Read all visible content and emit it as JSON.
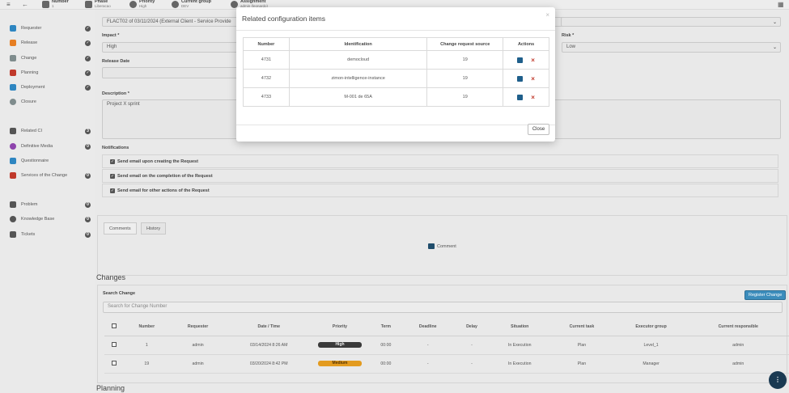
{
  "topbar": {
    "menu_icon": "menu-icon",
    "back_icon": "back-arrow-icon",
    "items": [
      {
        "label": "Number",
        "value": "1"
      },
      {
        "label": "Phase",
        "value": "Liberacao"
      },
      {
        "label": "Priority",
        "value": "High"
      },
      {
        "label": "Current group",
        "value": "DEV"
      },
      {
        "label": "Assignment",
        "value": "admin (leonardo)"
      }
    ],
    "grid_icon": "grid-icon"
  },
  "sidebar": {
    "items": [
      {
        "label": "Requester",
        "icon": "user-icon",
        "color": "#2e86c1",
        "badge": "check"
      },
      {
        "label": "Release",
        "icon": "release-icon",
        "color": "#e67e22",
        "badge": "check"
      },
      {
        "label": "Change",
        "icon": "swap-icon",
        "color": "#7f8c8d",
        "badge": "check"
      },
      {
        "label": "Planning",
        "icon": "calendar-icon",
        "color": "#c0392b",
        "badge": "check"
      },
      {
        "label": "Deployment",
        "icon": "cloud-icon",
        "color": "#2e86c1",
        "badge": "check"
      },
      {
        "label": "Closure",
        "icon": "circle-icon",
        "color": "#7f8c8d",
        "badge": ""
      },
      {
        "label": "Related CI",
        "icon": "monitor-icon",
        "color": "#555555",
        "badge": "3"
      },
      {
        "label": "Definitive Media",
        "icon": "media-icon",
        "color": "#8e44ad",
        "badge": "0"
      },
      {
        "label": "Questionnaire",
        "icon": "list-icon",
        "color": "#2e86c1",
        "badge": ""
      },
      {
        "label": "Services of the Change",
        "icon": "warning-icon",
        "color": "#c0392b",
        "badge": "0"
      },
      {
        "label": "Problem",
        "icon": "alert-icon",
        "color": "#555555",
        "badge": "0"
      },
      {
        "label": "Knowledge Base",
        "icon": "gear-icon",
        "color": "#555555",
        "badge": "0"
      },
      {
        "label": "Tickets",
        "icon": "ticket-icon",
        "color": "#555555",
        "badge": "0"
      }
    ]
  },
  "form": {
    "title_value": "FLACT02 of 03/11/2024 (External Client - Service Provide",
    "impact_label": "Impact *",
    "impact_value": "High",
    "risk_label": "Risk *",
    "risk_value": "Low",
    "release_date_label": "Release Date",
    "description_label": "Description *",
    "description_value": "Project X sprint",
    "notifications_label": "Notifications",
    "notifications": [
      "Send email upon creating the Request",
      "Send email on the completion of the Request",
      "Send email for other actions of the Request"
    ]
  },
  "tabs": {
    "comments": "Comments",
    "history": "History",
    "comment_button": "Comment"
  },
  "changes": {
    "section_title": "Changes",
    "search_label": "Search Change",
    "search_placeholder": "Search for Change Number",
    "register_button": "Register Change",
    "columns": [
      "Number",
      "Requester",
      "Date / Time",
      "Priority",
      "Term",
      "Deadline",
      "Delay",
      "Situation",
      "Current task",
      "Executor group",
      "Current responsible"
    ],
    "rows": [
      {
        "number": "1",
        "requester": "admin",
        "datetime": "03/14/2024 8:26 AM",
        "priority": "High",
        "priority_color": "#3a3a3a",
        "term": "00:00",
        "deadline": "-",
        "delay": "-",
        "situation": "In Execution",
        "task": "Plan",
        "group": "Level_1",
        "responsible": "admin"
      },
      {
        "number": "19",
        "requester": "admin",
        "datetime": "03/20/2024 8:42 PM",
        "priority": "Medium",
        "priority_color": "#e39b1f",
        "term": "00:00",
        "deadline": "-",
        "delay": "-",
        "situation": "In Execution",
        "task": "Plan",
        "group": "Manager",
        "responsible": "admin"
      }
    ]
  },
  "planning_title": "Planning",
  "fab_label": "⋮",
  "modal": {
    "title": "Related configuration items",
    "close_x": "×",
    "columns": [
      "Number",
      "Identification",
      "Change request source",
      "Actions"
    ],
    "rows": [
      {
        "number": "4731",
        "identification": "democloud",
        "source": "19"
      },
      {
        "number": "4732",
        "identification": "zimon-intelligence-instance",
        "source": "19"
      },
      {
        "number": "4733",
        "identification": "M-001 de 65A",
        "source": "19"
      }
    ],
    "close_button": "Close"
  }
}
